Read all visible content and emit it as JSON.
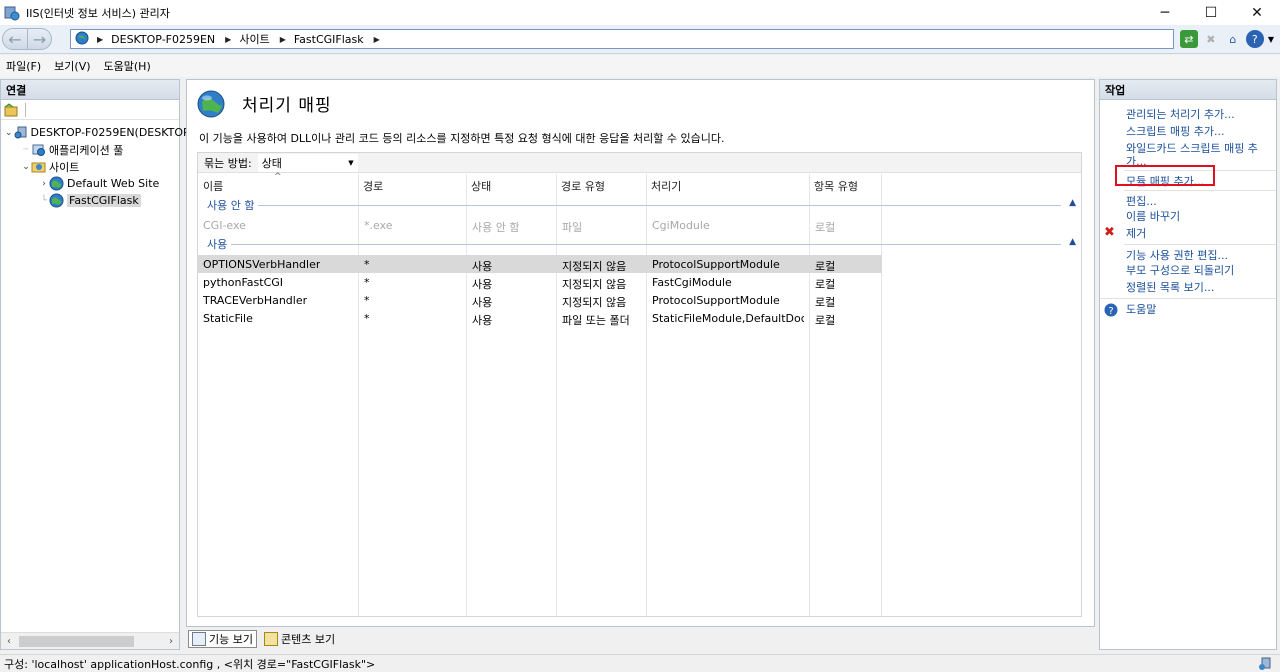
{
  "window": {
    "title": "IIS(인터넷 정보 서비스) 관리자",
    "controls": [
      "─",
      "☐",
      "✕"
    ]
  },
  "address": {
    "crumbs": [
      "DESKTOP-F0259EN",
      "사이트",
      "FastCGIFlask"
    ]
  },
  "menu": [
    "파일(F)",
    "보기(V)",
    "도움말(H)"
  ],
  "left": {
    "header": "연결",
    "tree": [
      {
        "label": "DESKTOP-F0259EN(DESKTOP",
        "toggle": "⌄",
        "icon": "server-icon",
        "indent": 0
      },
      {
        "label": "애플리케이션 풀",
        "toggle": "",
        "icon": "app-pool-icon",
        "indent": 1
      },
      {
        "label": "사이트",
        "toggle": "⌄",
        "icon": "sites-folder-icon",
        "indent": 1
      },
      {
        "label": "Default Web Site",
        "toggle": "›",
        "icon": "globe-icon",
        "indent": 2
      },
      {
        "label": "FastCGIFlask",
        "toggle": "",
        "icon": "globe-icon",
        "indent": 2,
        "selected": true
      }
    ]
  },
  "center": {
    "title": "처리기 매핑",
    "description": "이 기능을 사용하여 DLL이나 관리 코드 등의 리소스를 지정하면 특정 요청 형식에 대한 응답을 처리할 수 있습니다.",
    "group_by_label": "묶는 방법:",
    "group_by_value": "상태",
    "columns": [
      "이름",
      "경로",
      "상태",
      "경로 유형",
      "처리기",
      "항목 유형"
    ],
    "groups": [
      {
        "label": "사용 안 함",
        "rows": [
          {
            "name": "CGI-exe",
            "path": "*.exe",
            "state": "사용 안 함",
            "path_type": "파일",
            "handler": "CgiModule",
            "entry_type": "로컬"
          }
        ]
      },
      {
        "label": "사용",
        "rows": [
          {
            "name": "OPTIONSVerbHandler",
            "path": "*",
            "state": "사용",
            "path_type": "지정되지 않음",
            "handler": "ProtocolSupportModule",
            "entry_type": "로컬"
          },
          {
            "name": "pythonFastCGI",
            "path": "*",
            "state": "사용",
            "path_type": "지정되지 않음",
            "handler": "FastCgiModule",
            "entry_type": "로컬"
          },
          {
            "name": "TRACEVerbHandler",
            "path": "*",
            "state": "사용",
            "path_type": "지정되지 않음",
            "handler": "ProtocolSupportModule",
            "entry_type": "로컬"
          },
          {
            "name": "StaticFile",
            "path": "*",
            "state": "사용",
            "path_type": "파일 또는 폴더",
            "handler": "StaticFileModule,DefaultDoc...",
            "entry_type": "로컬"
          }
        ]
      }
    ],
    "tabs": [
      "기능 보기",
      "콘텐츠 보기"
    ]
  },
  "right": {
    "header": "작업",
    "actions": [
      {
        "label": "관리되는 처리기 추가..."
      },
      {
        "label": "스크립트 매핑 추가..."
      },
      {
        "label": "와일드카드 스크립트 매핑 추가..."
      },
      {
        "label": "모듈 매핑 추가..."
      },
      {
        "label": "편집..."
      },
      {
        "label": "이름 바꾸기"
      },
      {
        "label": "제거"
      },
      {
        "label": "기능 사용 권한 편집..."
      },
      {
        "label": "부모 구성으로 되돌리기"
      },
      {
        "label": "정렬된 목록 보기..."
      },
      {
        "label": "도움말"
      }
    ]
  },
  "status": {
    "text": "구성: 'localhost' applicationHost.config , <위치 경로=\"FastCGIFlask\">"
  },
  "colors": {
    "link": "#1b4f9a",
    "highlight": "#e0101e",
    "selection": "#d9d9d9"
  }
}
